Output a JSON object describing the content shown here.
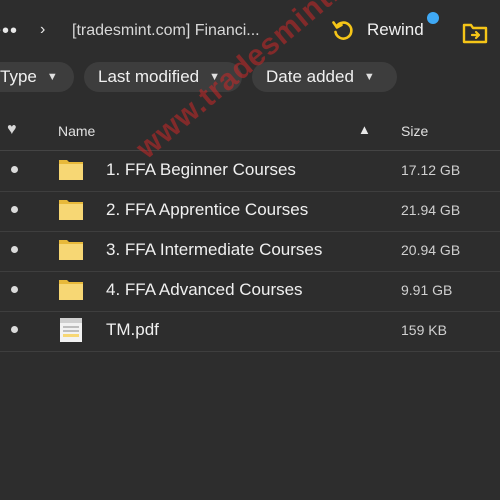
{
  "topbar": {
    "more_label": "•••",
    "crumb_separator": "›",
    "breadcrumb": "[tradesmint.com] Financi...",
    "rewind_label": "Rewind"
  },
  "filters": [
    {
      "label": "Type"
    },
    {
      "label": "Last modified"
    },
    {
      "label": "Date added"
    }
  ],
  "table": {
    "columns": {
      "name": "Name",
      "size": "Size"
    },
    "rows": [
      {
        "type": "folder",
        "name": "1. FFA Beginner Courses",
        "size": "17.12 GB"
      },
      {
        "type": "folder",
        "name": "2. FFA Apprentice Courses",
        "size": "21.94 GB"
      },
      {
        "type": "folder",
        "name": "3. FFA Intermediate Courses",
        "size": "20.94 GB"
      },
      {
        "type": "folder",
        "name": "4. FFA Advanced Courses",
        "size": "9.91 GB"
      },
      {
        "type": "pdf",
        "name": "TM.pdf",
        "size": "159 KB"
      }
    ]
  },
  "watermark": "www.tradesmint.com",
  "colors": {
    "background": "#2d2d2d",
    "accent_yellow": "#f5c518",
    "notification_dot": "#3fa9f5",
    "folder_yellow": "#f7d774",
    "watermark_red": "#c82828"
  }
}
